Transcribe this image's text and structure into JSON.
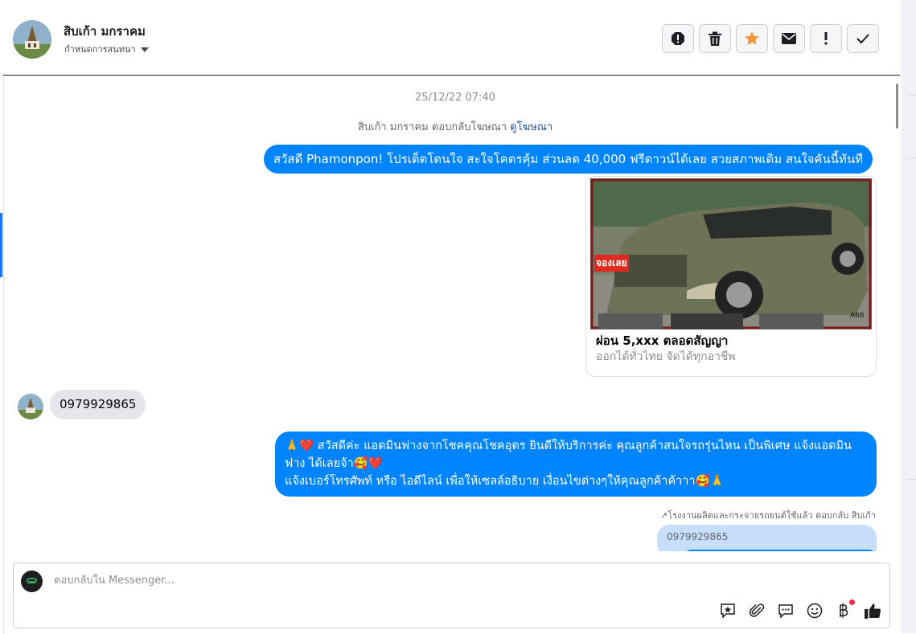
{
  "header": {
    "name": "สิบเก้า มกราคม",
    "assign_label": "กำหนดการสนทนา",
    "actions": [
      {
        "icon": "alert-icon"
      },
      {
        "icon": "trash-icon"
      },
      {
        "icon": "star-icon"
      },
      {
        "icon": "envelope-icon"
      },
      {
        "icon": "exclamation-icon"
      },
      {
        "icon": "check-icon"
      }
    ]
  },
  "conversation": {
    "timestamp": "25/12/22 07:40",
    "ad_reply_text": "สิบเก้า มกราคม ตอบกลับโฆษณา",
    "ad_reply_link": "ดูโฆษณา",
    "messages": {
      "outgoing_1": "สวัสดี Phamonpon! โปรเด็ดโดนใจ สะใจโคตรคุ้ม ส่วนลด 40,000 ฟรีดาวน์ได้เลย สวยสภาพเดิม สนใจคันนี้ทันที",
      "ad_card": {
        "image_label": "จองเลย",
        "image_code": "A66",
        "title": "ผ่อน 5,xxx ตลอดสัญญา",
        "subtitle": "ออกได้ทั่วไทย จัดได้ทุกอาชีพ"
      },
      "incoming_phone": "0979929865",
      "outgoing_2_line1": "🙏❤️ สวัสดีค่ะ แอดมินฟางจากโชคคุณโชคอุดร ยินดีให้บริการค่ะ   คุณลูกค้าสนใจรถรุ่นไหน เป็นพิเศษ แจ้งแอดมินฟาง ได้เลยจ้า🥰❤️",
      "outgoing_2_line2": "แจ้งเบอร์โทรศัพท์ หรือ ไอดีไลน์ เพื่อให้เซลล์อธิบาย เงื่อนไขต่างๆให้คุณลูกค้าค้าาา🥰🙏",
      "reply_note": "↗โรงงานผลิตและกระจายรถยนต์ใช้แล้ว ตอบกลับ สิบเก้า",
      "quoted": "0979929865"
    }
  },
  "composer": {
    "placeholder": "ตอบกลับใน Messenger...",
    "tools": [
      "saved-reply-icon",
      "attachment-icon",
      "chat-icon",
      "emoji-icon",
      "baht-icon",
      "thumbs-up-icon"
    ]
  },
  "colors": {
    "accent": "#0084ff",
    "incoming_bubble": "#e4e6eb",
    "star": "#f7923b"
  }
}
